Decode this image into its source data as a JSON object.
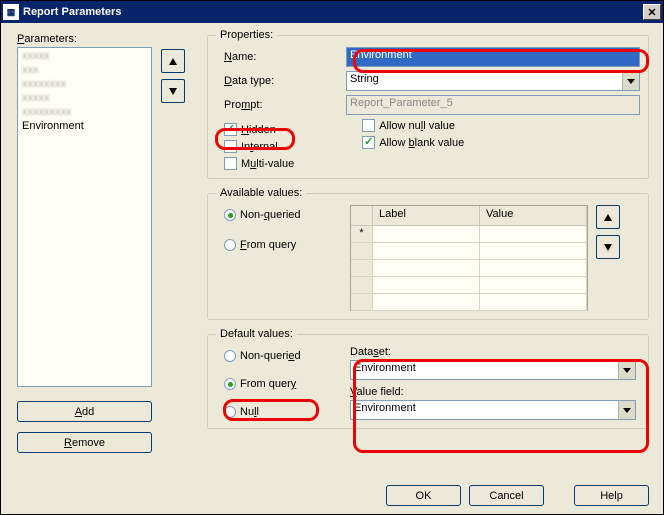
{
  "window": {
    "title": "Report Parameters"
  },
  "parametersLabel": "Parameters:",
  "paramsList": {
    "blurred": [
      "xxxxx",
      "xxx",
      "xxxxxxxx",
      "xxxxx",
      "xxxxxxxxx"
    ],
    "selected": "Environment"
  },
  "buttons": {
    "add": "Add",
    "remove": "Remove",
    "ok": "OK",
    "cancel": "Cancel",
    "help": "Help"
  },
  "properties": {
    "legend": "Properties:",
    "nameLabel": "Name:",
    "nameValue": "Environment",
    "dataTypeLabel": "Data type:",
    "dataTypeValue": "String",
    "promptLabel": "Prompt:",
    "promptValue": "Report_Parameter_5",
    "hidden": {
      "label": "Hidden",
      "checked": true
    },
    "internal": {
      "label": "Internal",
      "checked": false
    },
    "multi": {
      "label": "Multi-value",
      "checked": false
    },
    "allowNull": {
      "label": "Allow null value",
      "checked": false
    },
    "allowBlank": {
      "label": "Allow blank value",
      "checked": true
    }
  },
  "available": {
    "legend": "Available values:",
    "nonQueried": "Non-queried",
    "fromQuery": "From query",
    "selected": "non",
    "gridHeaders": {
      "label": "Label",
      "value": "Value"
    },
    "rowMarker": "*"
  },
  "defaults": {
    "legend": "Default values:",
    "nonQueried": "Non-queried",
    "fromQuery": "From query",
    "null": "Null",
    "selected": "from",
    "datasetLabel": "Dataset:",
    "datasetValue": "Environment",
    "valueFieldLabel": "Value field:",
    "valueFieldValue": "Environment"
  }
}
